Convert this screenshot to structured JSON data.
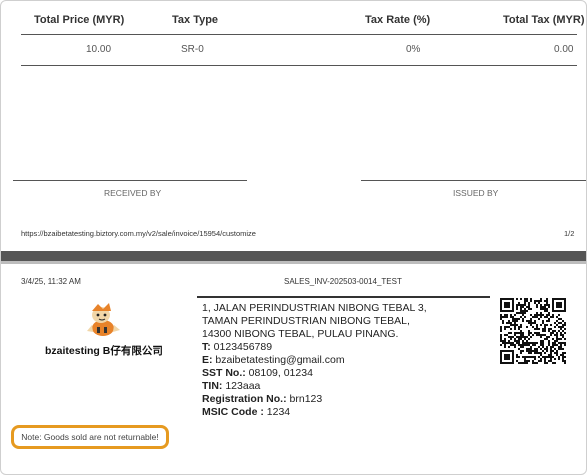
{
  "table": {
    "headers": [
      "Total Price (MYR)",
      "Tax Type",
      "Tax Rate (%)",
      "Total Tax (MYR)"
    ],
    "row": [
      "10.00",
      "SR-0",
      "0%",
      "0.00"
    ]
  },
  "signatures": {
    "received": "RECEIVED BY",
    "issued": "ISSUED BY"
  },
  "footer": {
    "url": "https://bzaibetatesting.biztory.com.my/v2/sale/invoice/15954/customize",
    "page": "1/2"
  },
  "page2": {
    "datetime": "3/4/25, 11:32 AM",
    "doc_title": "SALES_INV-202503-0014_TEST",
    "company_name": "bzaitesting B仔有限公司",
    "address": [
      "1, JALAN PERINDUSTRIAN NIBONG TEBAL 3,",
      "TAMAN PERINDUSTRIAN NIBONG TEBAL,",
      "14300 NIBONG TEBAL, PULAU PINANG."
    ],
    "contacts": [
      {
        "label": "T:",
        "value": "0123456789"
      },
      {
        "label": "E:",
        "value": "bzaibetatesting@gmail.com"
      },
      {
        "label": "SST No.:",
        "value": "08109, 01234"
      },
      {
        "label": "TIN:",
        "value": "123aaa"
      },
      {
        "label": "Registration No.:",
        "value": "brn123"
      },
      {
        "label": "MSIC Code :",
        "value": "1234"
      }
    ],
    "note": "Note: Goods sold are not returnable!"
  },
  "colors": {
    "highlight": "#e69a20",
    "band": "#555555"
  },
  "icons": {
    "logo": "mascot-logo",
    "qr": "qr-code"
  }
}
